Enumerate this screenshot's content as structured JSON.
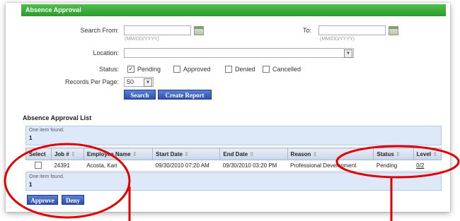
{
  "title": "Absence Approval",
  "search": {
    "from_label": "Search From:",
    "to_label": "To:",
    "from_value": "",
    "to_value": "",
    "date_hint_from": "(MM/DD/YYYY)",
    "date_hint_to": "(MM/DD/YYYY)",
    "location_label": "Location:",
    "location_value": "",
    "status_label": "Status:",
    "statuses": [
      {
        "label": "Pending",
        "checked": true
      },
      {
        "label": "Approved",
        "checked": false
      },
      {
        "label": "Denied",
        "checked": false
      },
      {
        "label": "Cancelled",
        "checked": false
      }
    ],
    "records_label": "Records Per Page:",
    "records_value": "50",
    "search_button": "Search",
    "report_button": "Create Report"
  },
  "list": {
    "title": "Absence Approval List",
    "found_text": "One item found.",
    "page_number": "1",
    "columns": [
      "Select",
      "Job #",
      "Employee Name",
      "Start Date",
      "End Date",
      "Reason",
      "Status",
      "Level"
    ],
    "rows": [
      {
        "job": "24391",
        "employee": "Acosta, Kari",
        "start": "09/30/2010 07:20 AM",
        "end": "09/30/2010 03:20 PM",
        "reason": "Professional Development",
        "status": "Pending",
        "level": "0/2"
      }
    ],
    "approve_button": "Approve",
    "deny_button": "Deny"
  },
  "colors": {
    "header_green": "#2e9a2e",
    "button_blue": "#2f50b0",
    "annotation_red": "#e00000"
  }
}
